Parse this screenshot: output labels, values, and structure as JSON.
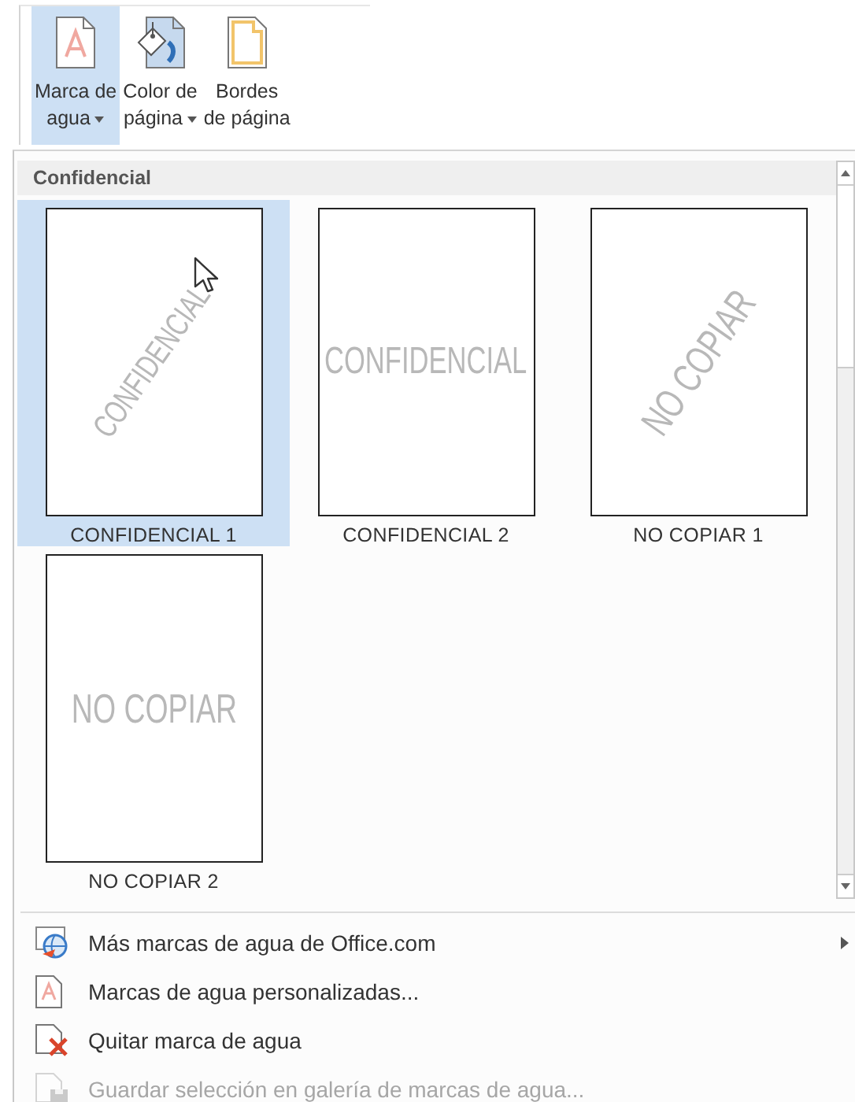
{
  "ribbon": {
    "buttons": [
      {
        "lines": [
          "Marca de",
          "agua"
        ],
        "dropdown": true,
        "selected": true
      },
      {
        "lines": [
          "Color de",
          "página"
        ],
        "dropdown": true,
        "selected": false
      },
      {
        "lines": [
          "Bordes",
          "de página"
        ],
        "dropdown": false,
        "selected": false
      }
    ]
  },
  "gallery": {
    "heading": "Confidencial",
    "items": [
      {
        "watermark": "CONFIDENCIAL",
        "caption": "CONFIDENCIAL 1",
        "kind": "diagonal",
        "selected": true
      },
      {
        "watermark": "CONFIDENCIAL",
        "caption": "CONFIDENCIAL 2",
        "kind": "horizontal",
        "selected": false
      },
      {
        "watermark": "NO COPIAR",
        "caption": "NO COPIAR 1",
        "kind": "diagonal",
        "selected": false
      },
      {
        "watermark": "NO COPIAR",
        "caption": "NO COPIAR 2",
        "kind": "horizontal",
        "selected": false
      }
    ]
  },
  "menu": [
    {
      "label": "Más marcas de agua de Office.com",
      "submenu": true,
      "disabled": false
    },
    {
      "label": "Marcas de agua personalizadas...",
      "submenu": false,
      "disabled": false
    },
    {
      "label": "Quitar marca de agua",
      "submenu": false,
      "disabled": false
    },
    {
      "label": "Guardar selección en galería de marcas de agua...",
      "submenu": false,
      "disabled": true
    }
  ]
}
